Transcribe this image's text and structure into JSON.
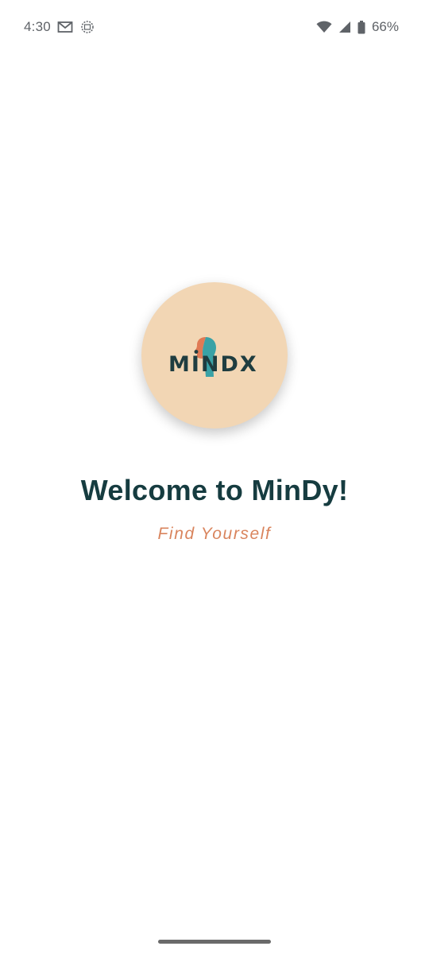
{
  "status_bar": {
    "time": "4:30",
    "battery_percent": "66%",
    "icons": [
      "gmail-icon",
      "app-notification-icon",
      "wifi-icon",
      "cellular-signal-icon",
      "battery-icon"
    ]
  },
  "logo": {
    "text": "MINDX",
    "circle_color": "#f2d6b4",
    "text_color": "#1f3d40",
    "accent_colors": [
      "#e07a55",
      "#3aa2a6"
    ]
  },
  "welcome": {
    "title": "Welcome to MinDy!",
    "tagline": "Find Yourself"
  },
  "colors": {
    "title": "#163c40",
    "tagline": "#d9845d",
    "background": "#ffffff"
  }
}
